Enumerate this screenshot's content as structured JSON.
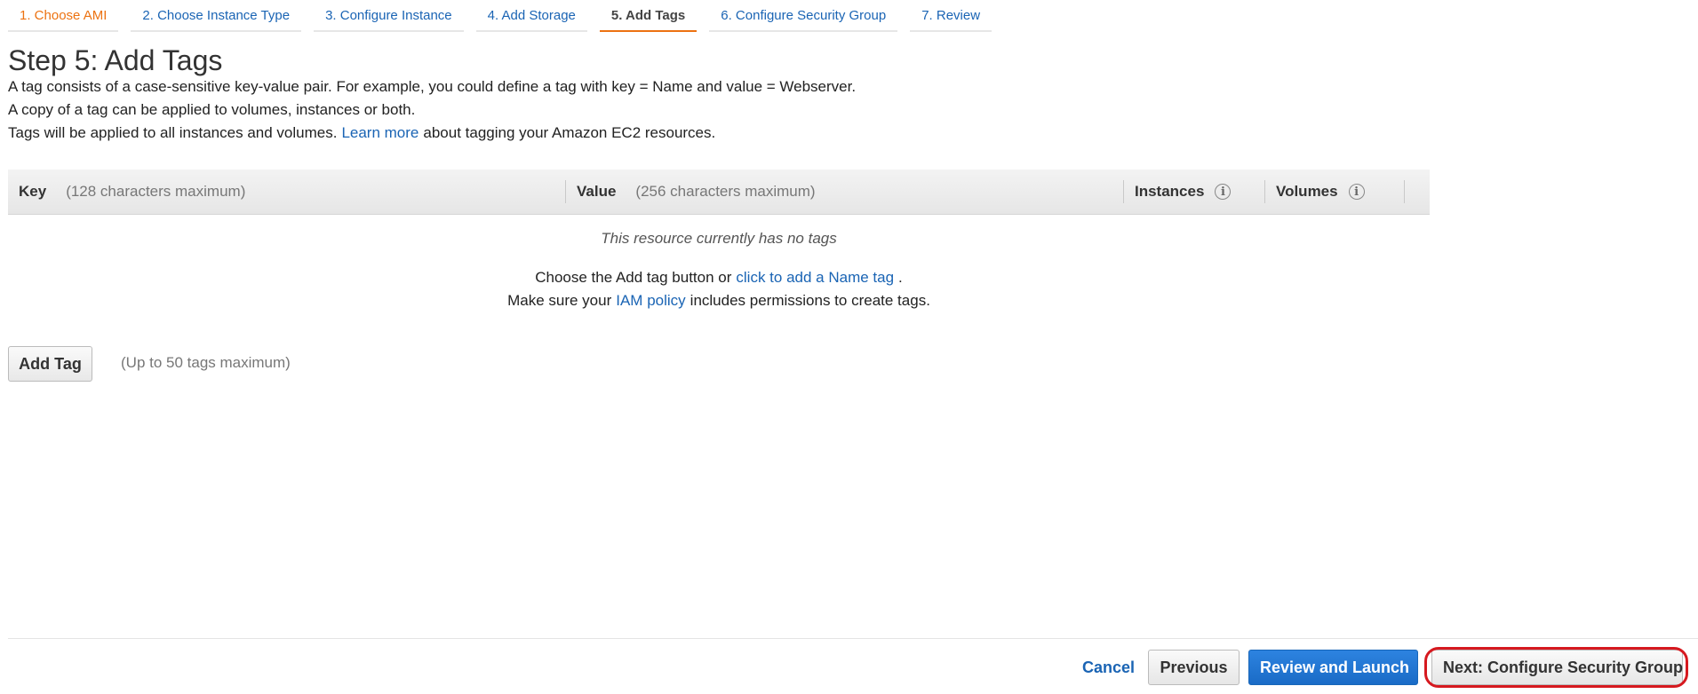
{
  "wizard": {
    "tabs": [
      {
        "label": "1. Choose AMI",
        "state": "done"
      },
      {
        "label": "2. Choose Instance Type",
        "state": "pending"
      },
      {
        "label": "3. Configure Instance",
        "state": "pending"
      },
      {
        "label": "4. Add Storage",
        "state": "pending"
      },
      {
        "label": "5. Add Tags",
        "state": "active"
      },
      {
        "label": "6. Configure Security Group",
        "state": "pending"
      },
      {
        "label": "7. Review",
        "state": "pending"
      }
    ]
  },
  "header": {
    "title": "Step 5: Add Tags",
    "line1": "A tag consists of a case-sensitive key-value pair. For example, you could define a tag with key = Name and value = Webserver.",
    "line2": "A copy of a tag can be applied to volumes, instances or both.",
    "line3_prefix": "Tags will be applied to all instances and volumes.",
    "line3_link": "Learn more",
    "line3_suffix": "about tagging your Amazon EC2 resources."
  },
  "table": {
    "columns": {
      "key_label": "Key",
      "key_hint": "(128 characters maximum)",
      "value_label": "Value",
      "value_hint": "(256 characters maximum)",
      "instances_label": "Instances",
      "volumes_label": "Volumes",
      "info_glyph": "i"
    },
    "empty": {
      "message": "This resource currently has no tags",
      "line1_prefix": "Choose the Add tag button or",
      "line1_link": "click to add a Name tag",
      "line1_suffix": ".",
      "line2_prefix": "Make sure your",
      "line2_link": "IAM policy",
      "line2_suffix": "includes permissions to create tags."
    }
  },
  "add_tag": {
    "button_label": "Add Tag",
    "hint": "(Up to 50 tags maximum)"
  },
  "footer": {
    "cancel_label": "Cancel",
    "previous_label": "Previous",
    "review_label": "Review and Launch",
    "next_label": "Next: Configure Security Group"
  },
  "colors": {
    "link": "#1a64b4",
    "active_tab_accent": "#ec7211",
    "primary_button": "#1a6bc6",
    "highlight_ring": "#d6191f"
  }
}
